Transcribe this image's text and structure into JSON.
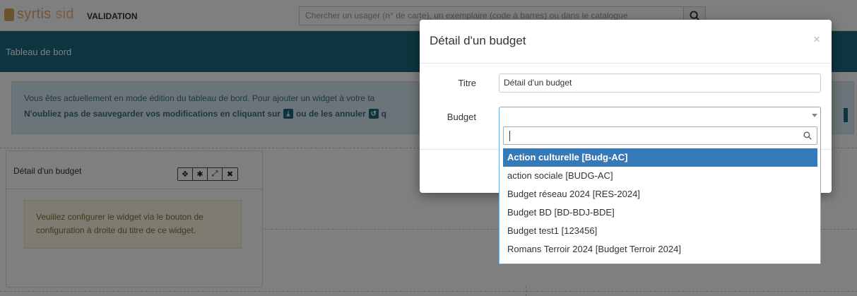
{
  "app": {
    "logo_text": "syrtis",
    "logo_suffix": "sid",
    "environment": "VALIDATION",
    "search_placeholder": "Chercher un usager (n° de carte), un exemplaire (code à barres) ou dans le catalogue"
  },
  "page": {
    "title": "Tableau de bord"
  },
  "info": {
    "line1": "Vous êtes actuellement en mode édition du tableau de bord. Pour ajouter un widget à votre ta",
    "line2_start": "N'oubliez pas de sauvegarder vos modifications en cliquant sur",
    "line2_mid": "ou de les annuler",
    "line2_end": "q"
  },
  "widget": {
    "title": "Détail d'un budget",
    "warning": "Veuillez configurer le widget via le bouton de configuration à droite du titre de ce widget."
  },
  "modal": {
    "title": "Détail d'un budget",
    "close": "×",
    "title_label": "Titre",
    "title_value": "Détail d'un budget",
    "budget_label": "Budget"
  },
  "dropdown": {
    "options": [
      "Action culturelle [Budg-AC]",
      "action sociale [BUDG-AC]",
      "Budget réseau 2024 [RES-2024]",
      "Budget BD [BD-BDJ-BDE]",
      "Budget test1 [123456]",
      "Romans Terroir 2024 [Budget Terroir 2024]"
    ],
    "selected_index": 0
  },
  "colors": {
    "brand_teal": "#1d6a7f",
    "highlight_blue": "#3579b8",
    "logo_orange": "#e8a96a"
  }
}
